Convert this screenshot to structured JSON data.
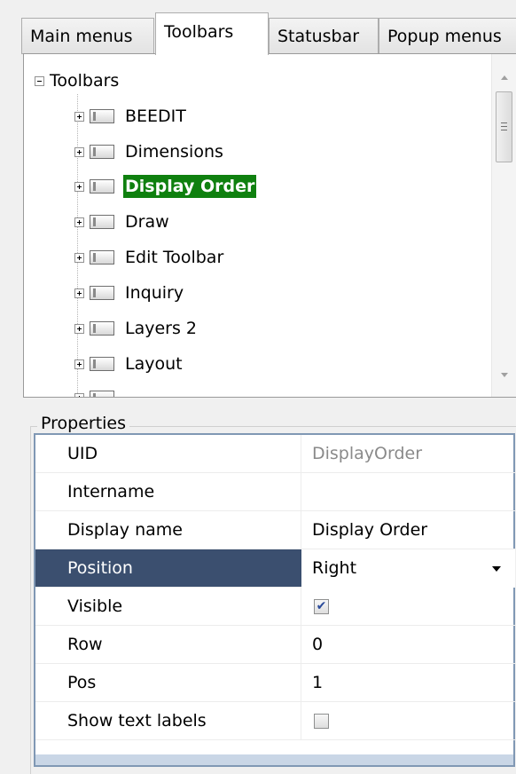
{
  "tabs": [
    "Main menus",
    "Toolbars",
    "Statusbar",
    "Popup menus"
  ],
  "tree": {
    "root": "Toolbars",
    "items": [
      {
        "label": "BEEDIT",
        "selected": false
      },
      {
        "label": "Dimensions",
        "selected": false
      },
      {
        "label": "Display Order",
        "selected": true
      },
      {
        "label": "Draw",
        "selected": false
      },
      {
        "label": "Edit Toolbar",
        "selected": false
      },
      {
        "label": "Inquiry",
        "selected": false
      },
      {
        "label": "Layers 2",
        "selected": false
      },
      {
        "label": "Layout",
        "selected": false
      }
    ],
    "selected_color": "#0f800f"
  },
  "properties": {
    "title": "Properties",
    "rows": [
      {
        "name": "UID",
        "value": "DisplayOrder"
      },
      {
        "name": "Intername",
        "value": ""
      },
      {
        "name": "Display name",
        "value": "Display Order"
      },
      {
        "name": "Position",
        "value": "Right"
      },
      {
        "name": "Visible",
        "checked": true
      },
      {
        "name": "Row",
        "value": "0"
      },
      {
        "name": "Pos",
        "value": "1"
      },
      {
        "name": "Show text labels",
        "checked": false
      }
    ],
    "selected_row_color": "#3b4f6f"
  }
}
